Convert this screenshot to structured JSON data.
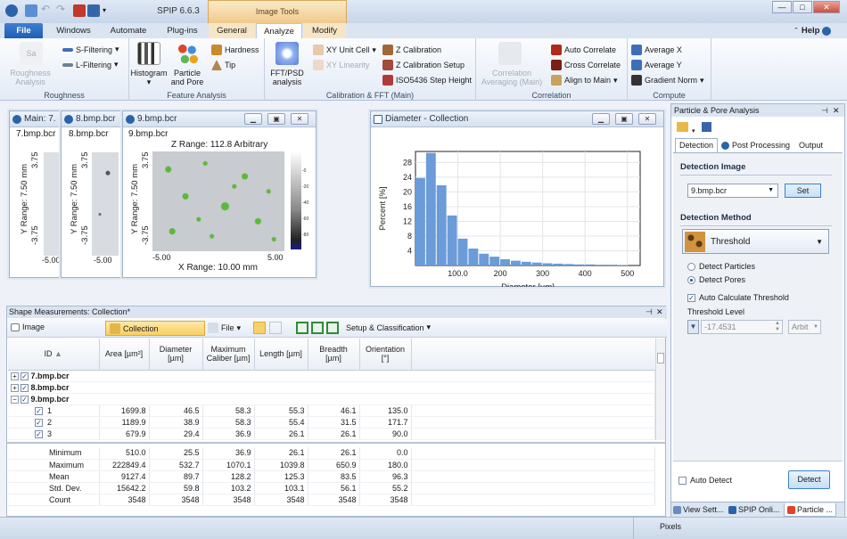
{
  "app": {
    "title": "SPIP 6.6.3",
    "context_tab": "Image Tools",
    "help": "Help"
  },
  "tabs": [
    {
      "label": "File"
    },
    {
      "label": "Windows"
    },
    {
      "label": "Automate"
    },
    {
      "label": "Plug-ins"
    },
    {
      "label": "General"
    },
    {
      "label": "Analyze"
    },
    {
      "label": "Modify"
    }
  ],
  "ribbon": {
    "roughness": {
      "title": "Roughness",
      "roughness_analysis": "Roughness Analysis",
      "sfilter": "S-Filtering",
      "lfilter": "L-Filtering",
      "sa": "Sa"
    },
    "feature": {
      "title": "Feature Analysis",
      "histogram": "Histogram",
      "particle": "Particle and Pore",
      "hardness": "Hardness",
      "tip": "Tip"
    },
    "calib": {
      "title": "Calibration & FFT (Main)",
      "fft": "FFT/PSD analysis",
      "xy_unit": "XY Unit Cell",
      "xy_lin": "XY Linearity",
      "z_cal": "Z Calibration",
      "z_cal_setup": "Z Calibration Setup",
      "iso": "ISO5436 Step Height"
    },
    "corr": {
      "title": "Correlation",
      "corr_avg": "Correlation Averaging (Main)",
      "auto": "Auto Correlate",
      "cross": "Cross Correlate",
      "align": "Align to Main"
    },
    "compute": {
      "title": "Compute",
      "avgx": "Average X",
      "avgy": "Average Y",
      "grad": "Gradient Norm"
    }
  },
  "image_windows": [
    {
      "title": "Main: 7.",
      "file": "7.bmp.bcr",
      "yrange": "Y Range: 7.50 mm",
      "ticks_y": [
        "3.75",
        "-3.75"
      ],
      "tick_x": "-5.00"
    },
    {
      "title": "8.bmp.bcr",
      "file": "8.bmp.bcr",
      "yrange": "Y Range: 7.50 mm",
      "ticks_y": [
        "3.75",
        "-3.75"
      ],
      "tick_x": "-5.00"
    },
    {
      "title": "9.bmp.bcr",
      "file": "9.bmp.bcr",
      "zrange": "Z Range:  112.8 Arbitrary",
      "yrange": "Y Range: 7.50 mm",
      "ticks_y": [
        "3.75",
        "-3.75"
      ],
      "ticks_x": [
        "-5.00",
        "5.00"
      ],
      "xrange": "X Range: 10.00 mm",
      "colorbar": [
        "-0",
        "-20",
        "-40",
        "-60",
        "-80"
      ]
    }
  ],
  "histogram_window": {
    "title": "Diameter - Collection"
  },
  "chart_data": {
    "type": "bar",
    "title": "",
    "xlabel": "Diameter [µm]",
    "ylabel": "Percent [%]",
    "x_ticks": [
      "100.0",
      "200",
      "300",
      "400",
      "500"
    ],
    "y_ticks": [
      "4",
      "8",
      "12",
      "16",
      "20",
      "24",
      "28"
    ],
    "xlim": [
      0,
      530
    ],
    "ylim": [
      0,
      31
    ],
    "bin_width": 25,
    "bin_starts": [
      0,
      25,
      50,
      75,
      100,
      125,
      150,
      175,
      200,
      225,
      250,
      275,
      300,
      325,
      350,
      375,
      400,
      425,
      450,
      475
    ],
    "values": [
      23.8,
      30.6,
      21.8,
      13.6,
      7.3,
      4.6,
      3.2,
      2.4,
      1.7,
      1.3,
      1.0,
      0.8,
      0.6,
      0.5,
      0.4,
      0.3,
      0.3,
      0.2,
      0.2,
      0.1
    ],
    "bar_color": "#6b9bd8",
    "grid": true
  },
  "shape_panel": {
    "header": "Shape Measurements:  Collection*",
    "tabs": {
      "image": "Image",
      "collection": "Collection",
      "file": "File",
      "setup": "Setup & Classification"
    },
    "columns": [
      "ID",
      "Area [µm²]",
      "Diameter [µm]",
      "Maximum Caliber [µm]",
      "Length [µm]",
      "Breadth [µm]",
      "Orientation [°]"
    ],
    "groups": [
      {
        "label": "7.bmp.bcr",
        "expand": "+"
      },
      {
        "label": "8.bmp.bcr",
        "expand": "+"
      },
      {
        "label": "9.bmp.bcr",
        "expand": "−"
      }
    ],
    "rows": [
      {
        "id": "1",
        "area": "1699.8",
        "diameter": "46.5",
        "caliber": "58.3",
        "length": "55.3",
        "breadth": "46.1",
        "orientation": "135.0"
      },
      {
        "id": "2",
        "area": "1189.9",
        "diameter": "38.9",
        "caliber": "58.3",
        "length": "55.4",
        "breadth": "31.5",
        "orientation": "171.7"
      },
      {
        "id": "3",
        "area": "679.9",
        "diameter": "29.4",
        "caliber": "36.9",
        "length": "26.1",
        "breadth": "26.1",
        "orientation": "90.0"
      }
    ],
    "stats": [
      {
        "label": "Minimum",
        "area": "510.0",
        "diameter": "25.5",
        "caliber": "36.9",
        "length": "26.1",
        "breadth": "26.1",
        "orientation": "0.0"
      },
      {
        "label": "Maximum",
        "area": "222849.4",
        "diameter": "532.7",
        "caliber": "1070.1",
        "length": "1039.8",
        "breadth": "650.9",
        "orientation": "180.0"
      },
      {
        "label": "Mean",
        "area": "9127.4",
        "diameter": "89.7",
        "caliber": "128.2",
        "length": "125.3",
        "breadth": "83.5",
        "orientation": "96.3"
      },
      {
        "label": "Std. Dev.",
        "area": "15642.2",
        "diameter": "59.8",
        "caliber": "103.2",
        "length": "103.1",
        "breadth": "56.1",
        "orientation": "55.2"
      },
      {
        "label": "Count",
        "area": "3548",
        "diameter": "3548",
        "caliber": "3548",
        "length": "3548",
        "breadth": "3548",
        "orientation": "3548"
      }
    ]
  },
  "ppa": {
    "title": "Particle & Pore Analysis",
    "tabs": [
      "Detection",
      "Post Processing",
      "Output"
    ],
    "detection_image_label": "Detection Image",
    "image_select": "9.bmp.bcr",
    "set": "Set",
    "method_label": "Detection Method",
    "method": "Threshold",
    "detect_particles": "Detect Particles",
    "detect_pores": "Detect Pores",
    "auto_calc": "Auto Calculate Threshold",
    "threshold_label": "Threshold Level",
    "threshold_value": "-17.4531",
    "threshold_unit": "Arbit",
    "auto_detect": "Auto Detect",
    "detect": "Detect",
    "bottom_tabs": [
      "View Sett...",
      "SPIP Onli...",
      "Particle ..."
    ]
  },
  "status": {
    "text": "Pixels"
  }
}
